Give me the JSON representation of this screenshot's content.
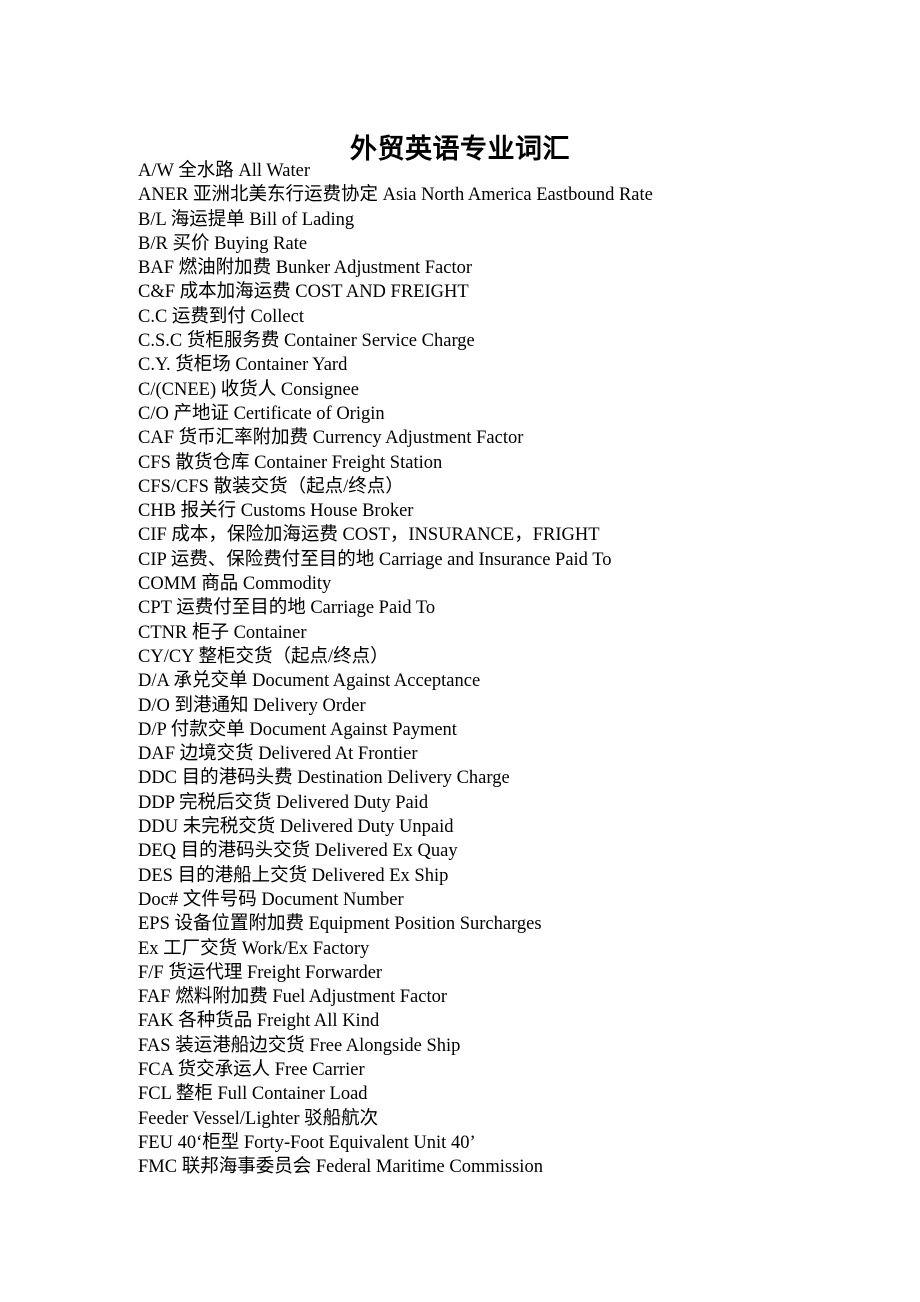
{
  "document": {
    "title": "外贸英语专业词汇",
    "background_color": "#ffffff",
    "text_color": "#000000"
  },
  "glossary": {
    "entries": [
      {
        "line": "A/W  全水路  All Water"
      },
      {
        "line": "ANER  亚洲北美东行运费协定  Asia North America Eastbound Rate"
      },
      {
        "line": "B/L  海运提单  Bill of Lading"
      },
      {
        "line": "B/R  买价  Buying Rate"
      },
      {
        "line": "BAF  燃油附加费  Bunker Adjustment Factor"
      },
      {
        "line": "C&F  成本加海运费  COST AND FREIGHT"
      },
      {
        "line": "C.C  运费到付  Collect"
      },
      {
        "line": "C.S.C  货柜服务费  Container Service Charge"
      },
      {
        "line": "C.Y.  货柜场  Container Yard"
      },
      {
        "line": "C/(CNEE)  收货人  Consignee"
      },
      {
        "line": "C/O  产地证  Certificate of Origin"
      },
      {
        "line": "CAF  货币汇率附加费  Currency Adjustment Factor"
      },
      {
        "line": "CFS  散货仓库  Container Freight Station"
      },
      {
        "line": "CFS/CFS  散装交货（起点/终点）"
      },
      {
        "line": "CHB  报关行  Customs House Broker"
      },
      {
        "line": "CIF  成本，保险加海运费  COST，INSURANCE，FRIGHT"
      },
      {
        "line": "CIP  运费、保险费付至目的地  Carriage and Insurance Paid To"
      },
      {
        "line": "COMM  商品  Commodity"
      },
      {
        "line": "CPT  运费付至目的地  Carriage Paid To"
      },
      {
        "line": "CTNR  柜子  Container"
      },
      {
        "line": "CY/CY  整柜交货（起点/终点）"
      },
      {
        "line": "D/A  承兑交单  Document Against Acceptance"
      },
      {
        "line": "D/O  到港通知  Delivery Order"
      },
      {
        "line": "D/P  付款交单  Document Against Payment"
      },
      {
        "line": "DAF  边境交货  Delivered At Frontier"
      },
      {
        "line": "DDC  目的港码头费  Destination Delivery Charge"
      },
      {
        "line": "DDP  完税后交货  Delivered Duty Paid"
      },
      {
        "line": "DDU  未完税交货  Delivered Duty Unpaid"
      },
      {
        "line": "DEQ  目的港码头交货  Delivered Ex Quay"
      },
      {
        "line": "DES  目的港船上交货  Delivered Ex Ship"
      },
      {
        "line": "Doc#  文件号码  Document Number"
      },
      {
        "line": "EPS  设备位置附加费  Equipment Position Surcharges"
      },
      {
        "line": "Ex  工厂交货  Work/Ex Factory"
      },
      {
        "line": "F/F  货运代理  Freight Forwarder"
      },
      {
        "line": "FAF  燃料附加费  Fuel Adjustment Factor"
      },
      {
        "line": "FAK  各种货品  Freight All Kind"
      },
      {
        "line": "FAS  装运港船边交货  Free Alongside Ship"
      },
      {
        "line": "FCA  货交承运人  Free Carrier"
      },
      {
        "line": "FCL  整柜  Full Container Load"
      },
      {
        "line": "Feeder Vessel/Lighter  驳船航次"
      },
      {
        "line": "FEU 40‘柜型  Forty-Foot Equivalent Unit 40’"
      },
      {
        "line": "FMC  联邦海事委员会  Federal Maritime Commission"
      }
    ]
  }
}
